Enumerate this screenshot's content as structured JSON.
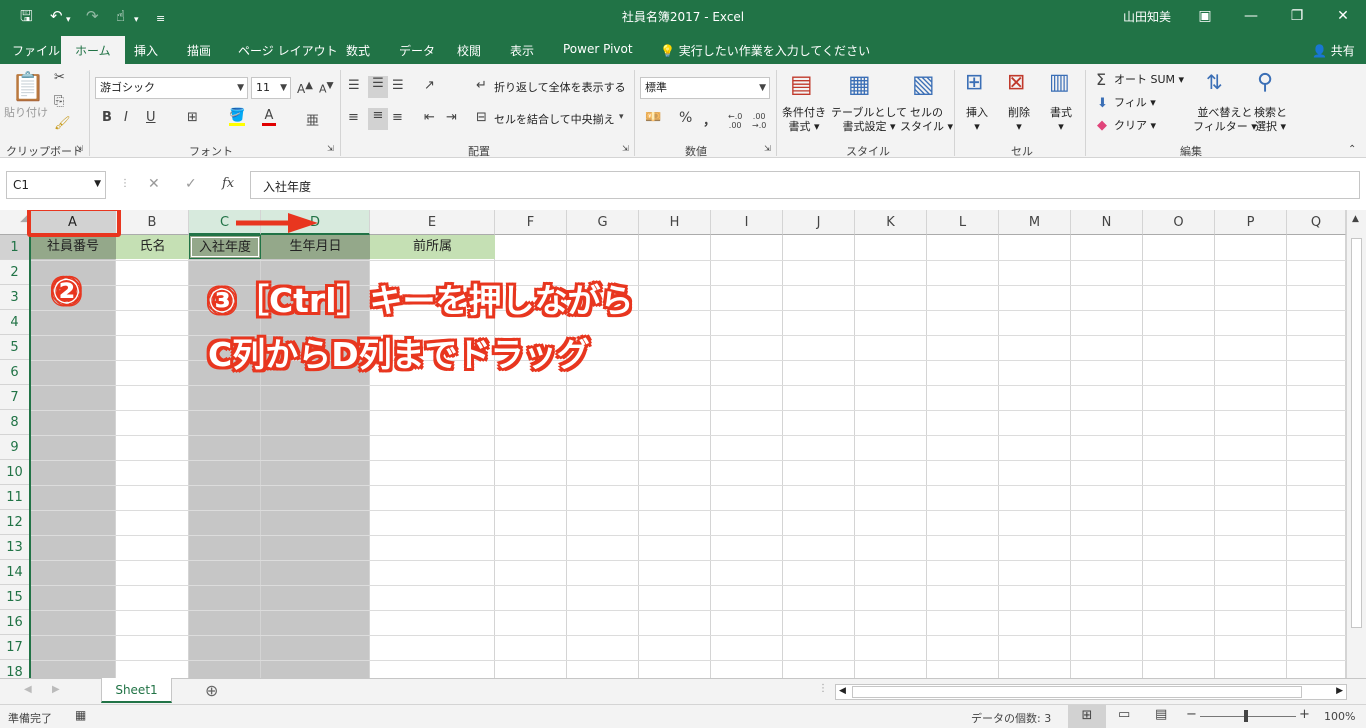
{
  "window": {
    "title": "社員名簿2017  -  Excel",
    "user": "山田知美",
    "share": "共有"
  },
  "tabs": [
    "ファイル",
    "ホーム",
    "挿入",
    "描画",
    "ページ レイアウト",
    "数式",
    "データ",
    "校閲",
    "表示",
    "Power Pivot"
  ],
  "tell_me": "実行したい作業を入力してください",
  "ribbon": {
    "clipboard": {
      "paste": "貼り付け",
      "label": "クリップボード"
    },
    "font": {
      "name": "游ゴシック",
      "size": "11",
      "bold": "B",
      "italic": "I",
      "underline": "U",
      "label": "フォント"
    },
    "alignment": {
      "wrap": "折り返して全体を表示する",
      "merge": "セルを結合して中央揃え",
      "label": "配置"
    },
    "number": {
      "format": "標準",
      "percent": "%",
      "comma": "，",
      "inc": ".00 .0",
      "label": "数値"
    },
    "styles": {
      "conditional_1": "条件付き",
      "conditional_2": "書式",
      "table_1": "テーブルとして",
      "table_2": "書式設定",
      "cell_1": "セルの",
      "cell_2": "スタイル",
      "label": "スタイル"
    },
    "cells": {
      "insert": "挿入",
      "delete": "削除",
      "format": "書式",
      "label": "セル"
    },
    "editing": {
      "autosum": "オート SUM",
      "fill": "フィル",
      "clear": "クリア",
      "sort_1": "並べ替えと",
      "sort_2": "フィルター",
      "find_1": "検索と",
      "find_2": "選択",
      "label": "編集"
    }
  },
  "formula_bar": {
    "name_box": "C1",
    "fx": "fx",
    "content": "入社年度"
  },
  "columns": [
    "A",
    "B",
    "C",
    "D",
    "E",
    "F",
    "G",
    "H",
    "I",
    "J",
    "K",
    "L",
    "M",
    "N",
    "O",
    "P",
    "Q"
  ],
  "rows": [
    "1",
    "2",
    "3",
    "4",
    "5",
    "6",
    "7",
    "8",
    "9",
    "10",
    "11",
    "12",
    "13",
    "14",
    "15",
    "16",
    "17",
    "18"
  ],
  "row1": {
    "A": "社員番号",
    "B": "氏名",
    "C": "入社年度",
    "D": "生年月日",
    "E": "前所属"
  },
  "sheet": {
    "tab": "Sheet1"
  },
  "status": {
    "ready": "準備完了",
    "count": "データの個数: 3",
    "zoom": "100%"
  },
  "annotations": {
    "step2": "②",
    "step3_line1": "③［Ctrl］キーを押しながら",
    "step3_line2": "C列からD列までドラッグ"
  },
  "colors": {
    "excel_green": "#217346",
    "annotation_red": "#e8361f",
    "header_fill": "#c5e0b4"
  }
}
